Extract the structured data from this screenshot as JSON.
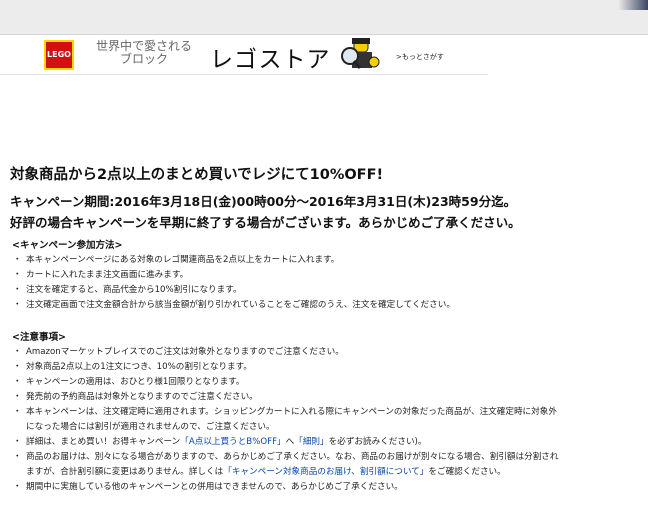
{
  "banner": {
    "logo_text": "LEGO",
    "tagline_line1": "世界中で愛される",
    "tagline_line2": "ブロック",
    "store_name": "レゴストア",
    "more_link": ">もっとさがす"
  },
  "headline": "対象商品から2点以上のまとめ買いでレジにて10%OFF!",
  "period": "キャンペーン期間:2016年3月18日(金)00時00分～2016年3月31日(木)23時59分迄。",
  "notice": "好評の場合キャンペーンを早期に終了する場合がございます。あらかじめご了承ください。",
  "how_to": {
    "title": "<キャンペーン参加方法>",
    "items": [
      "本キャンペーンページにある対象のレゴ関連商品を2点以上をカートに入れます。",
      "カートに入れたまま注文画面に進みます。",
      "注文を確定すると、商品代金から10%割引になります。",
      "注文確定画面で注文金額合計から該当金額が割り引かれていることをご確認のうえ、注文を確定してください。"
    ]
  },
  "notes": {
    "title": "<注意事項>",
    "item1": "Amazonマーケットプレイスでのご注文は対象外となりますのでご注意ください。",
    "item2": "対象商品2点以上の1注文につき、10%の割引となります。",
    "item3": "キャンペーンの適用は、おひとり様1回限りとなります。",
    "item4": "発売前の予約商品は対象外となりますのでご注意ください。",
    "item5_line1": "本キャンペーンは、注文確定時に適用されます。ショッピングカートに入れる際にキャンペーンの対象だった商品が、注文確定時に対象外",
    "item5_line2": "になった場合には割引が適用されませんので、ご注意ください。",
    "item6_pre": "詳細は、まとめ買い！お得キャンペーン",
    "item6_link1": "「A点以上買うとB%OFF」",
    "item6_mid": "へ",
    "item6_link2": "「細則」",
    "item6_post": "を必ずお読みください)。",
    "item7_line1": "商品のお届けは、別々になる場合がありますので、あらかじめご了承ください。なお、商品のお届けが別々になる場合、割引額は分割され",
    "item7_line2_pre": "ますが、合計割引額に変更はありません。詳しくは",
    "item7_link": "「キャンペーン対象商品のお届け、割引額について」",
    "item7_line2_post": "をご確認ください。",
    "item8": "期間中に実施している他のキャンペーンとの併用はできませんので、あらかじめご了承ください。"
  },
  "colors": {
    "link": "#0645ad",
    "lego_red": "#d01012",
    "lego_yellow": "#ffd500"
  }
}
